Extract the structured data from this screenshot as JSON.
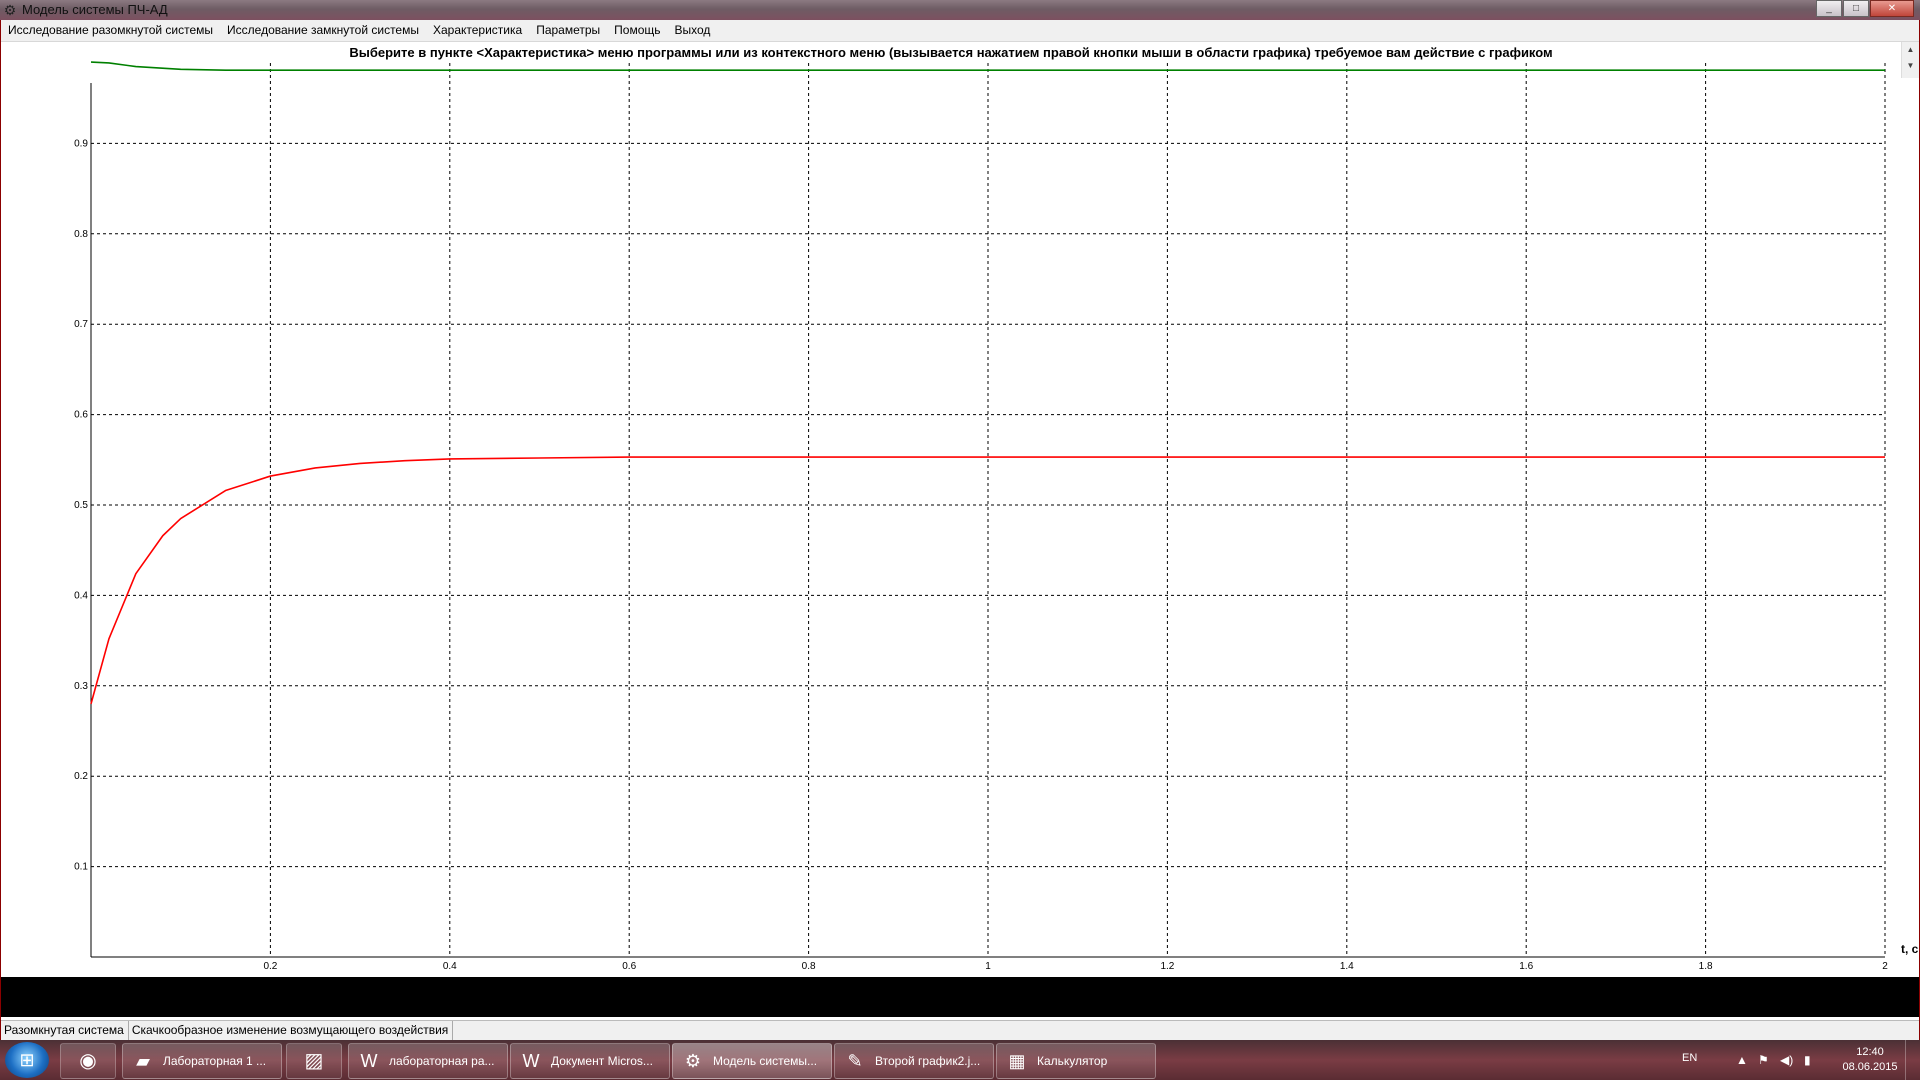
{
  "window": {
    "title": "Модель системы ПЧ-АД",
    "buttons": [
      "_",
      "□",
      "✕"
    ]
  },
  "menu": {
    "items": [
      "Исследование разомкнутой системы",
      "Исследование замкнутой системы",
      "Характеристика",
      "Параметры",
      "Помощь",
      "Выход"
    ]
  },
  "instruction": "Выберите в пункте <Характеристика> меню программы или из контекстного меню (вызывается нажатием правой кнопки мыши в области графика) требуемое вам действие с графиком",
  "chart_data": {
    "type": "line",
    "xlabel": "t, c",
    "ylabel": "",
    "xlim": [
      0,
      2
    ],
    "ylim": [
      0,
      1
    ],
    "grid": true,
    "x_ticks": [
      "0.2",
      "0.4",
      "0.6",
      "0.8",
      "1",
      "1.2",
      "1.4",
      "1.6",
      "1.8",
      "2"
    ],
    "y_ticks": [
      "0.1",
      "0.2",
      "0.3",
      "0.4",
      "0.5",
      "0.6",
      "0.7",
      "0.8",
      "0.9"
    ],
    "series": [
      {
        "color": "#008000",
        "x": [
          0,
          0.02,
          0.05,
          0.1,
          0.15,
          0.2,
          0.3,
          0.5,
          1.0,
          2.0
        ],
        "y": [
          0.99,
          0.989,
          0.985,
          0.982,
          0.981,
          0.981,
          0.981,
          0.981,
          0.981,
          0.981
        ]
      },
      {
        "color": "#ff0000",
        "x": [
          0,
          0.02,
          0.05,
          0.08,
          0.1,
          0.15,
          0.2,
          0.25,
          0.3,
          0.35,
          0.4,
          0.5,
          0.6,
          1.0,
          2.0
        ],
        "y": [
          0.28,
          0.352,
          0.424,
          0.466,
          0.485,
          0.516,
          0.532,
          0.541,
          0.546,
          0.549,
          0.551,
          0.552,
          0.553,
          0.553,
          0.553
        ]
      }
    ]
  },
  "status": {
    "mode": "Разомкнутая система",
    "description": "Скачкообразное изменение возмущающего воздействия"
  },
  "taskbar": {
    "tasks": [
      {
        "label": "Лабораторная 1 ...",
        "icon": "folder-icon"
      },
      {
        "label": "лабораторная ра...",
        "icon": "word-icon"
      },
      {
        "label": "Документ Micros...",
        "icon": "word-icon"
      },
      {
        "label": "Модель системы...",
        "icon": "gear-icon",
        "active": true
      },
      {
        "label": "Второй график2.j...",
        "icon": "paint-icon"
      },
      {
        "label": "Калькулятор",
        "icon": "calculator-icon"
      }
    ],
    "tray": {
      "language": "EN",
      "time": "12:40",
      "date": "08.06.2015"
    }
  }
}
